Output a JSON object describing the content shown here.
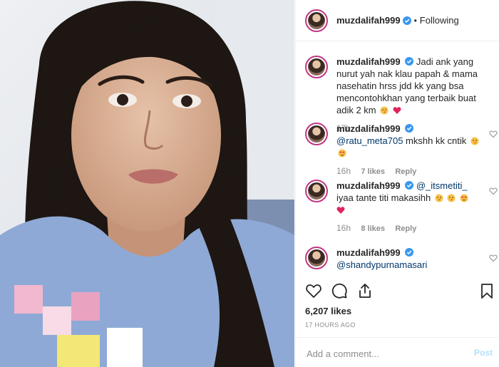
{
  "header": {
    "username": "muzdalifah999",
    "separator": "•",
    "follow_status": "Following"
  },
  "comments": [
    {
      "username": "muzdalifah999",
      "mention": "",
      "text": "Jadi ank yang nurut yah nak klau papah & mama nasehatin hrss jdd kk yang bsa mencontohkhan yang terbaik buat adik 2 km",
      "time": "17h",
      "likes": "",
      "reply": ""
    },
    {
      "username": "muzdalifah999",
      "mention": "@ratu_meta705",
      "text": "mkshh kk cntik",
      "time": "16h",
      "likes": "7 likes",
      "reply": "Reply"
    },
    {
      "username": "muzdalifah999",
      "mention": "@_itsmetiti_",
      "text": "iyaa tante titi makasihh",
      "time": "16h",
      "likes": "8 likes",
      "reply": "Reply"
    },
    {
      "username": "muzdalifah999",
      "mention": "@shandypurnamasari",
      "text": "",
      "time": "",
      "likes": "",
      "reply": ""
    }
  ],
  "actions": {
    "icons": [
      "heart-icon",
      "comment-icon",
      "share-icon",
      "bookmark-icon"
    ]
  },
  "likes_total": "6,207 likes",
  "post_age": "17 HOURS AGO",
  "add_comment": {
    "placeholder": "Add a comment...",
    "post_label": "Post"
  },
  "colors": {
    "link": "#00376b",
    "muted": "#8e8e8e",
    "verified": "#3897f0",
    "post_disabled": "#b2dffc"
  }
}
